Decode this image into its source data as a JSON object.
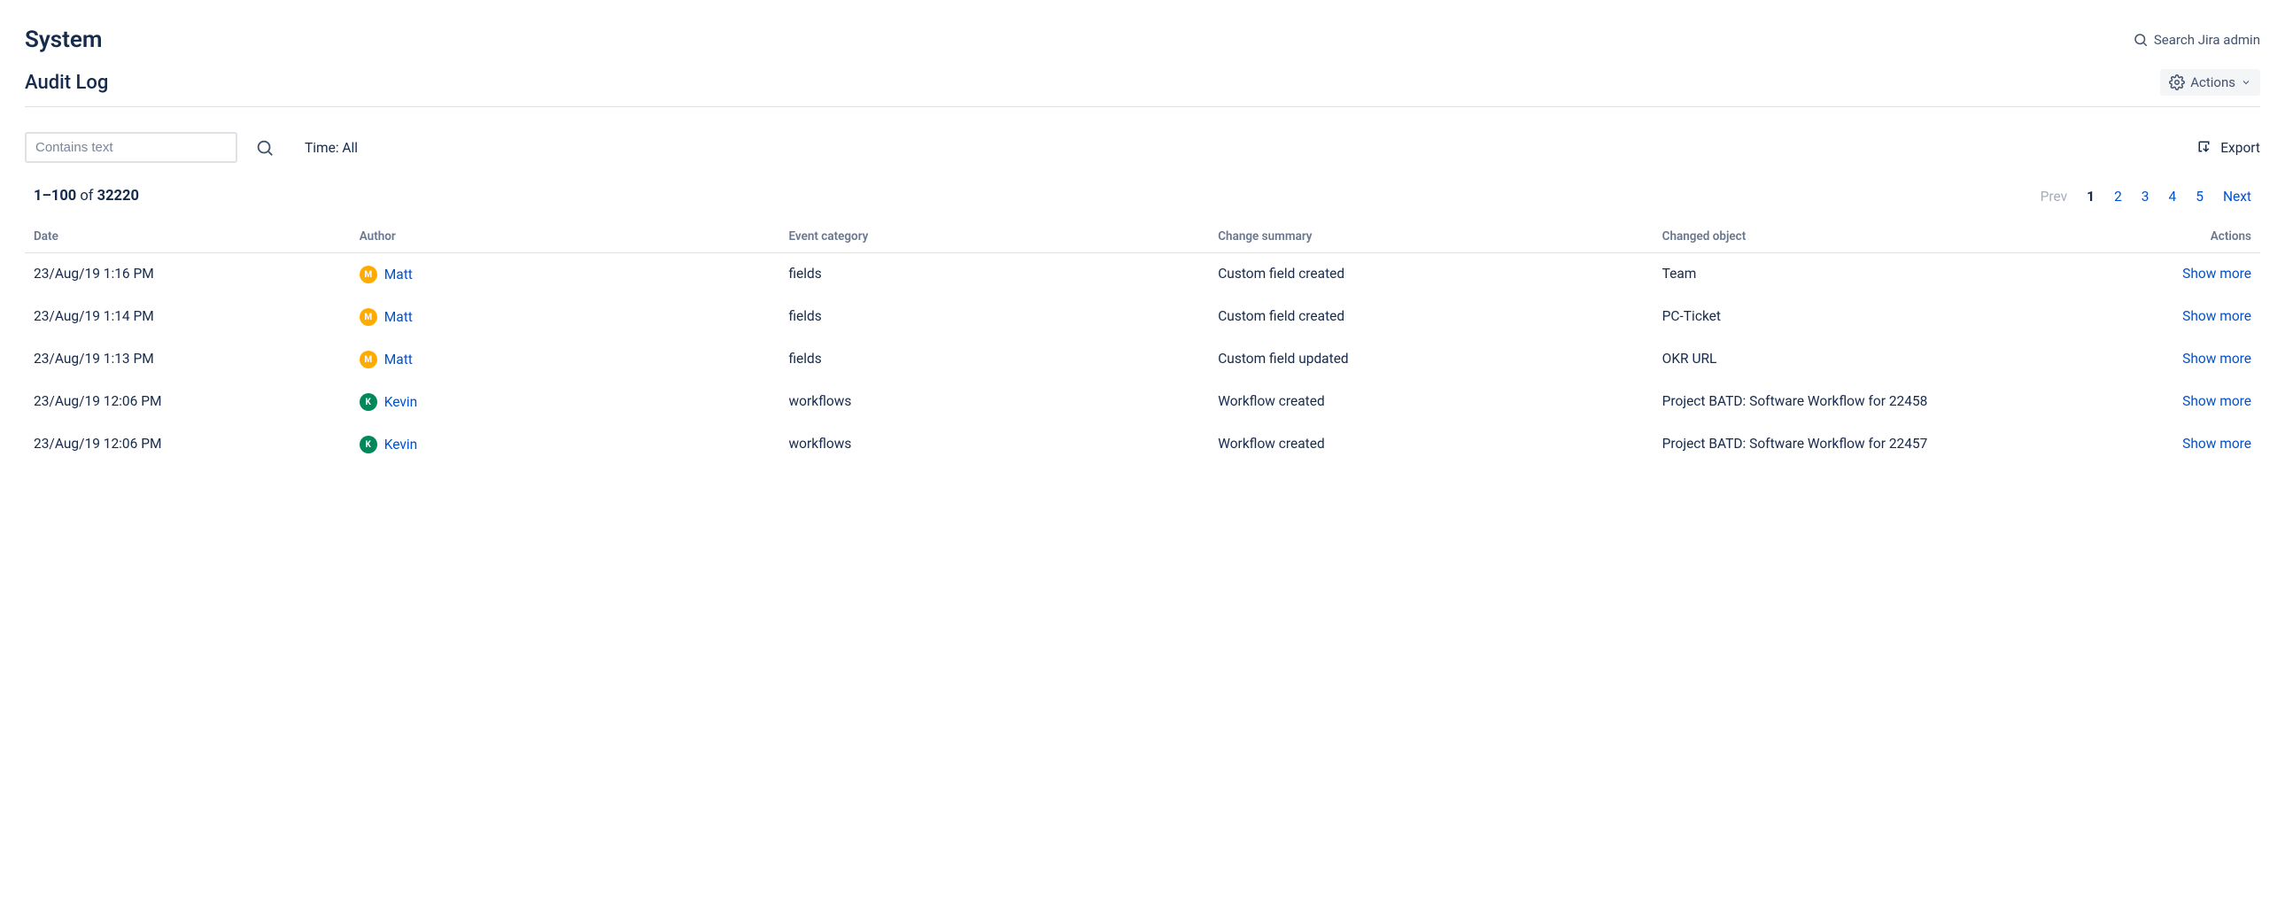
{
  "header": {
    "title": "System",
    "search_admin": "Search Jira admin"
  },
  "subheader": {
    "title": "Audit Log",
    "actions_label": "Actions"
  },
  "filters": {
    "text_placeholder": "Contains text",
    "time_label": "Time: All",
    "export_label": "Export"
  },
  "results": {
    "range": "1–100",
    "of_word": "of",
    "total": "32220"
  },
  "pager": {
    "prev": "Prev",
    "pages": [
      "1",
      "2",
      "3",
      "4",
      "5"
    ],
    "current_index": 0,
    "next": "Next"
  },
  "columns": {
    "date": "Date",
    "author": "Author",
    "category": "Event category",
    "summary": "Change summary",
    "object": "Changed object",
    "actions": "Actions"
  },
  "show_more": "Show more",
  "avatar_palette": {
    "Matt": "#FFAB00",
    "Kevin": "#00875A"
  },
  "rows": [
    {
      "date": "23/Aug/19 1:16 PM",
      "author": "Matt",
      "category": "fields",
      "summary": "Custom field created",
      "object": "Team"
    },
    {
      "date": "23/Aug/19 1:14 PM",
      "author": "Matt",
      "category": "fields",
      "summary": "Custom field created",
      "object": "PC-Ticket"
    },
    {
      "date": "23/Aug/19 1:13 PM",
      "author": "Matt",
      "category": "fields",
      "summary": "Custom field updated",
      "object": "OKR URL"
    },
    {
      "date": "23/Aug/19 12:06 PM",
      "author": "Kevin",
      "category": "workflows",
      "summary": "Workflow created",
      "object": "Project BATD: Software Workflow for 22458"
    },
    {
      "date": "23/Aug/19 12:06 PM",
      "author": "Kevin",
      "category": "workflows",
      "summary": "Workflow created",
      "object": "Project BATD: Software Workflow for 22457"
    }
  ]
}
